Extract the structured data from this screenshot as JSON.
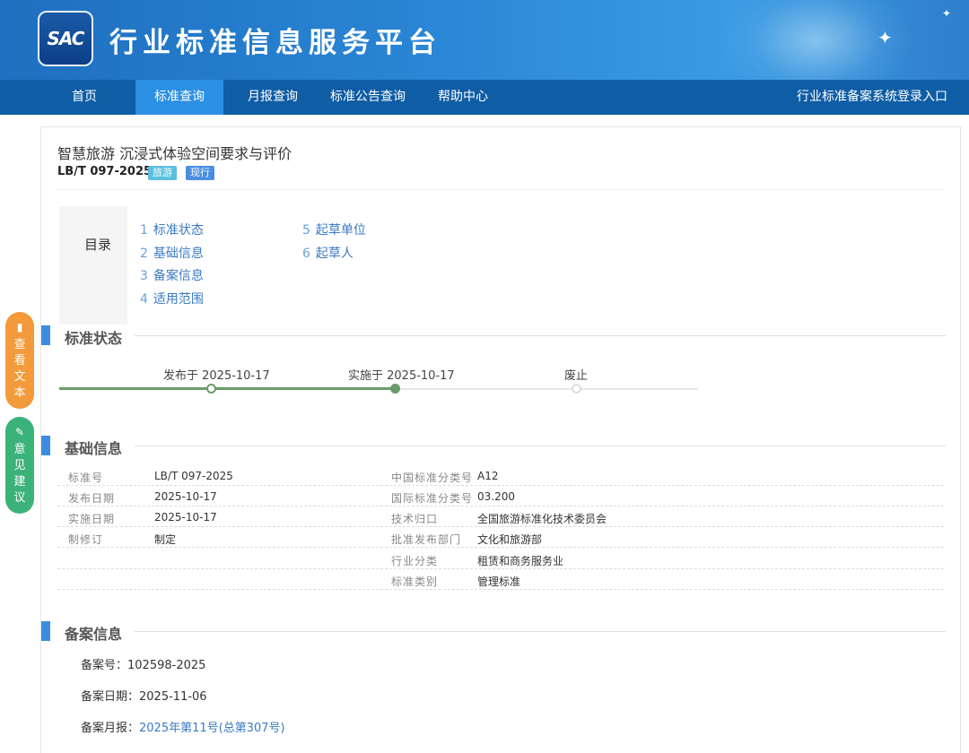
{
  "header": {
    "logo_text": "SAC",
    "site_title": "行业标准信息服务平台"
  },
  "nav": {
    "items": [
      "首页",
      "标准查询",
      "月报查询",
      "标准公告查询",
      "帮助中心"
    ],
    "active_index": 1,
    "login_link": "行业标准备案系统登录入口"
  },
  "standard": {
    "title": "智慧旅游 沉浸式体验空间要求与评价",
    "code": "LB/T 097-2025",
    "tags": [
      "旅游",
      "现行"
    ]
  },
  "toc": {
    "title": "目录",
    "items": [
      {
        "num": "1",
        "label": "标准状态"
      },
      {
        "num": "2",
        "label": "基础信息"
      },
      {
        "num": "3",
        "label": "备案信息"
      },
      {
        "num": "4",
        "label": "适用范围"
      },
      {
        "num": "5",
        "label": "起草单位"
      },
      {
        "num": "6",
        "label": "起草人"
      }
    ]
  },
  "status": {
    "heading": "标准状态",
    "steps": [
      "发布于 2025-10-17",
      "实施于 2025-10-17",
      "废止"
    ]
  },
  "basic": {
    "heading": "基础信息",
    "left": [
      {
        "label": "标准号",
        "value": "LB/T 097-2025"
      },
      {
        "label": "发布日期",
        "value": "2025-10-17"
      },
      {
        "label": "实施日期",
        "value": "2025-10-17"
      },
      {
        "label": "制修订",
        "value": "制定"
      }
    ],
    "right": [
      {
        "label": "中国标准分类号",
        "value": "A12"
      },
      {
        "label": "国际标准分类号",
        "value": "03.200"
      },
      {
        "label": "技术归口",
        "value": "全国旅游标准化技术委员会"
      },
      {
        "label": "批准发布部门",
        "value": "文化和旅游部"
      },
      {
        "label": "行业分类",
        "value": "租赁和商务服务业"
      },
      {
        "label": "标准类别",
        "value": "管理标准"
      }
    ]
  },
  "filing": {
    "heading": "备案信息",
    "number_label": "备案号：",
    "number": "102598-2025",
    "date_label": "备案日期：",
    "date": "2025-11-06",
    "monthly_label": "备案月报：",
    "monthly_link": "2025年第11号(总第307号)"
  },
  "side": {
    "view_text": [
      "查",
      "看",
      "文",
      "本"
    ],
    "feedback": [
      "意",
      "见",
      "建",
      "议"
    ]
  },
  "colors": {
    "nav_bg": "#0f5da5",
    "nav_active": "#2b8fe3",
    "accent_blue": "#3b8de0",
    "timeline_done": "#6b9a6b",
    "side_orange": "#f39a3b",
    "side_green": "#3bb27a"
  }
}
